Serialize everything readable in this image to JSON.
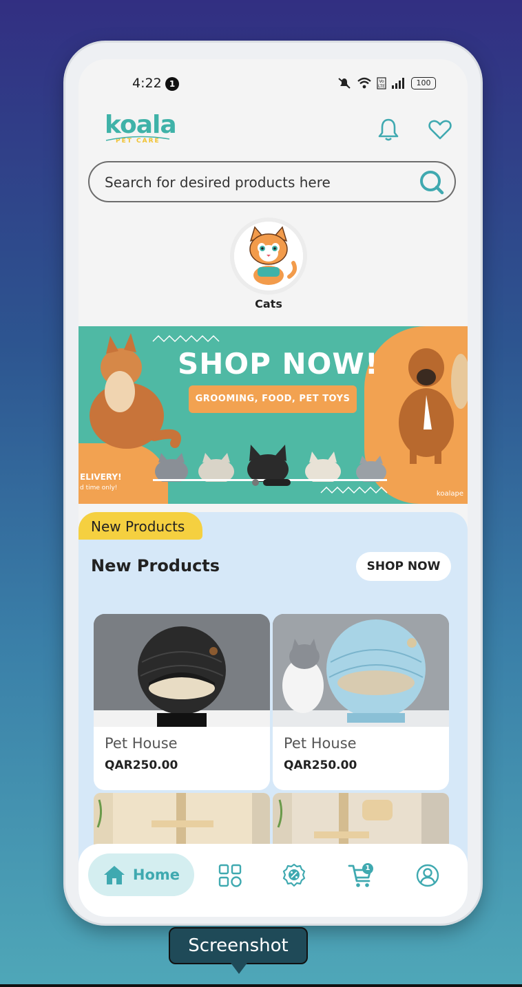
{
  "status_bar": {
    "time": "4:22",
    "notification_count": "1",
    "battery": "100"
  },
  "header": {
    "logo_text": "koala",
    "logo_subtext": "PET CARE"
  },
  "search": {
    "placeholder": "Search for desired products here"
  },
  "categories": [
    {
      "label": "Cats"
    }
  ],
  "banner": {
    "title": "SHOP NOW!",
    "pill": "GROOMING, FOOD, PET TOYS",
    "left_text": "ELIVERY!",
    "left_subtext": "d time only!",
    "brand": "koalape"
  },
  "new_products": {
    "tab_label": "New Products",
    "title": "New Products",
    "shop_now": "SHOP NOW",
    "items": [
      {
        "name": "Pet House",
        "price": "QAR250.00"
      },
      {
        "name": "Pet House",
        "price": "QAR250.00"
      }
    ]
  },
  "bottom_nav": {
    "home_label": "Home",
    "cart_count": "1"
  },
  "tooltip": {
    "label": "Screenshot"
  },
  "colors": {
    "brand_teal": "#3fb2a8",
    "banner_teal": "#4fb9a4",
    "banner_orange": "#f2a251",
    "tab_yellow": "#f5d040",
    "panel_blue": "#d6e8f8"
  }
}
